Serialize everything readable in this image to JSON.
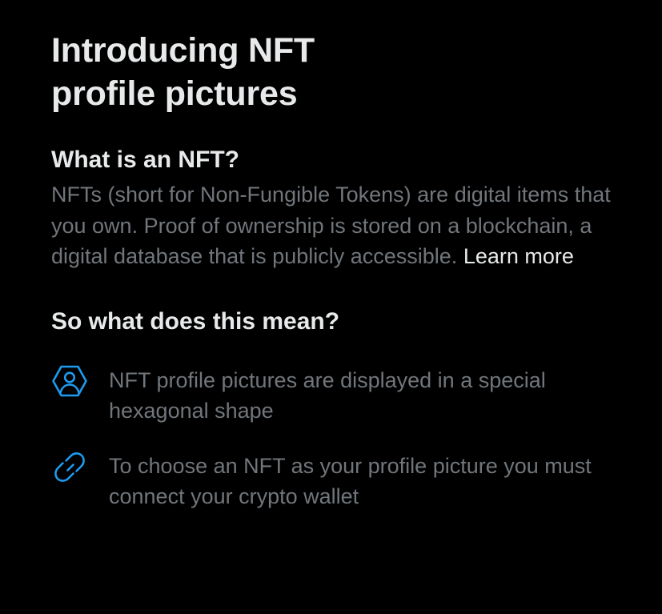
{
  "modal": {
    "title": "Introducing NFT profile pictures",
    "section_what": {
      "heading": "What is an NFT?",
      "body": "NFTs (short for Non-Fungible Tokens) are digital items that you own. Proof of ownership is stored on a blockchain, a digital database that is publicly accessible.",
      "link_label": "Learn more"
    },
    "section_meaning": {
      "heading": "So what does this mean?",
      "features": [
        {
          "icon": "hexagon-profile-icon",
          "text": "NFT profile pictures are displayed in a special hexagonal shape"
        },
        {
          "icon": "link-chain-icon",
          "text": "To choose an NFT as your profile picture you must connect your crypto wallet"
        }
      ]
    }
  },
  "colors": {
    "background": "#000000",
    "primary_text": "#E7E9EA",
    "secondary_text": "#71767B",
    "icon_accent": "#1D9BF0"
  }
}
